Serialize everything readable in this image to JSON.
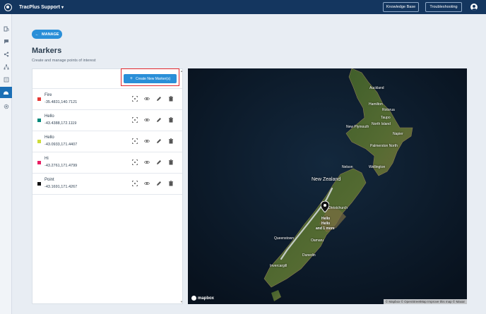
{
  "topbar": {
    "app_title": "TracPlus Support",
    "knowledge_base": "Knowledge Base",
    "troubleshooting": "Troubleshooting"
  },
  "back_button": "MANAGE",
  "page": {
    "title": "Markers",
    "subtitle": "Create and manage points of interest"
  },
  "create_button": "Create New Marker(s)",
  "markers": [
    {
      "name": "Fire",
      "coords": "-35.4831,140.7121",
      "color": "#e53935"
    },
    {
      "name": "Hello",
      "coords": "-43.4388,172.1119",
      "color": "#00897b"
    },
    {
      "name": "Hello",
      "coords": "-43.0933,171.4407",
      "color": "#cddc39"
    },
    {
      "name": "Hi",
      "coords": "-43.2761,171.4799",
      "color": "#e91e63"
    },
    {
      "name": "Point",
      "coords": "-43.1691,171.4267",
      "color": "#111111"
    }
  ],
  "map": {
    "labels": {
      "auckland": "Auckland",
      "hamilton": "Hamilton",
      "rotorua": "Rotorua",
      "taupo": "Taupo",
      "new_plymouth": "New Plymouth",
      "north_island": "North Island",
      "napier": "Napier",
      "palmerston_north": "Palmerston North",
      "wellington": "Wellington",
      "nelson": "Nelson",
      "new_zealand": "New Zealand",
      "christchurch": "Christchurch",
      "queenstown": "Queenstown",
      "dunedin": "Dunedin",
      "invercargill": "Invercargill",
      "oamaru": "Oamaru"
    },
    "cluster_lines": [
      "Hello",
      "Hello",
      "and 1 more"
    ],
    "brand": "mapbox",
    "attribution": "© Mapbox © OpenStreetMap Improve this map © Maxar"
  },
  "icons": {
    "rail": [
      "fuel-icon",
      "chat-icon",
      "share-icon",
      "org-icon",
      "list-icon",
      "markers-icon",
      "settings-icon"
    ],
    "row_actions": [
      "focus-icon",
      "eye-icon",
      "pencil-icon",
      "trash-icon"
    ]
  },
  "colors": {
    "topbar": "#14365f",
    "primary": "#2a8fd8",
    "highlight": "#e0262b"
  }
}
